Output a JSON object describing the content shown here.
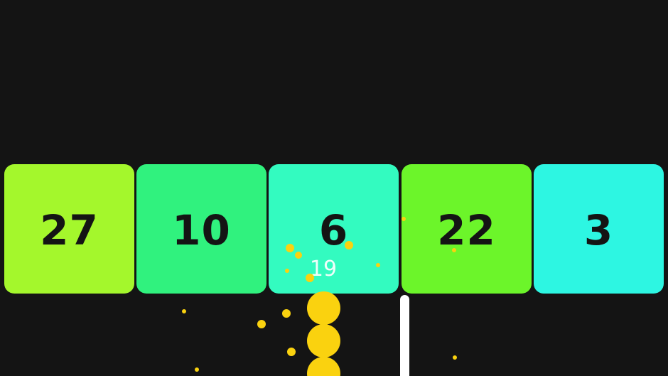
{
  "colors": {
    "background": "#141414",
    "snake": "#fad20f",
    "particle": "#fad20f",
    "wall": "#ffffff",
    "block_text": "#141414"
  },
  "blocks": [
    {
      "value": "27",
      "color": "#a4f72c"
    },
    {
      "value": "10",
      "color": "#30f27e"
    },
    {
      "value": "6",
      "color": "#33fbc0"
    },
    {
      "value": "22",
      "color": "#6cf52a"
    },
    {
      "value": "3",
      "color": "#2df6e2"
    }
  ],
  "snake": {
    "length": "19",
    "visible_segments": 3,
    "icon": "snake-ball-icon"
  },
  "particles_icon": "yellow-spark-particle-icon"
}
